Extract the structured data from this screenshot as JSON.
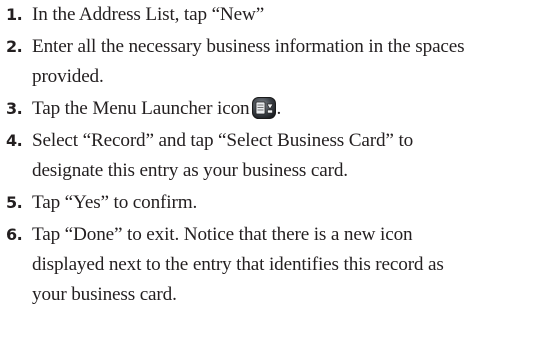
{
  "steps": [
    {
      "number": "1.",
      "lines": [
        "In the Address List, tap “New”"
      ]
    },
    {
      "number": "2.",
      "lines": [
        "Enter all the necessary business information in the spaces",
        "provided."
      ]
    },
    {
      "number": "3.",
      "lines": [
        "Tap the Menu Launcher icon"
      ],
      "trailing_period": ".",
      "icon": "menu-launcher-icon"
    },
    {
      "number": "4.",
      "lines": [
        "Select “Record” and tap “Select Business Card” to",
        "designate this entry as your business card."
      ]
    },
    {
      "number": "5.",
      "lines": [
        "Tap “Yes” to confirm."
      ]
    },
    {
      "number": "6.",
      "lines": [
        "Tap “Done” to exit. Notice that there is a new icon",
        "displayed next to the entry that identifies this record as",
        "your business card."
      ]
    }
  ]
}
